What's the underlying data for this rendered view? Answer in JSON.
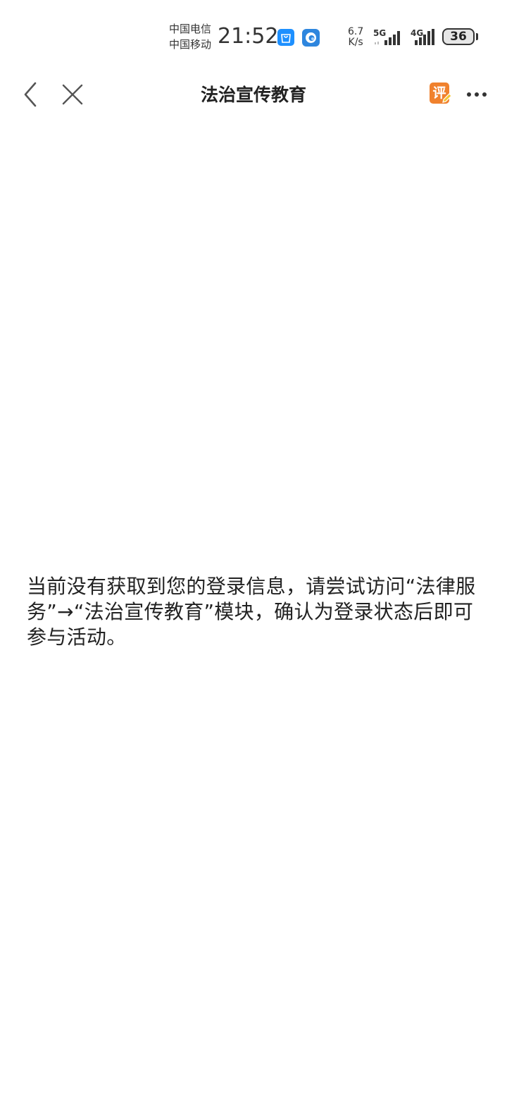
{
  "status_bar": {
    "carrier_1": "中国电信",
    "carrier_2": "中国移动",
    "time": "21:52",
    "net_speed_value": "6.7",
    "net_speed_unit": "K/s",
    "signal_1_label": "5G",
    "signal_2_label": "4G",
    "battery_level": "36",
    "app_icons": [
      "shopping-bag-icon",
      "browser-icon"
    ]
  },
  "nav": {
    "title": "法治宣传教育",
    "review_badge": "评",
    "icons": {
      "back": "chevron-left-icon",
      "close": "close-icon",
      "more": "more-dots-icon"
    },
    "colors": {
      "review_badge": "#f0812d"
    }
  },
  "content": {
    "message": "当前没有获取到您的登录信息，请尝试访问“法律服务”→“法治宣传教育”模块，确认为登录状态后即可参与活动。"
  }
}
